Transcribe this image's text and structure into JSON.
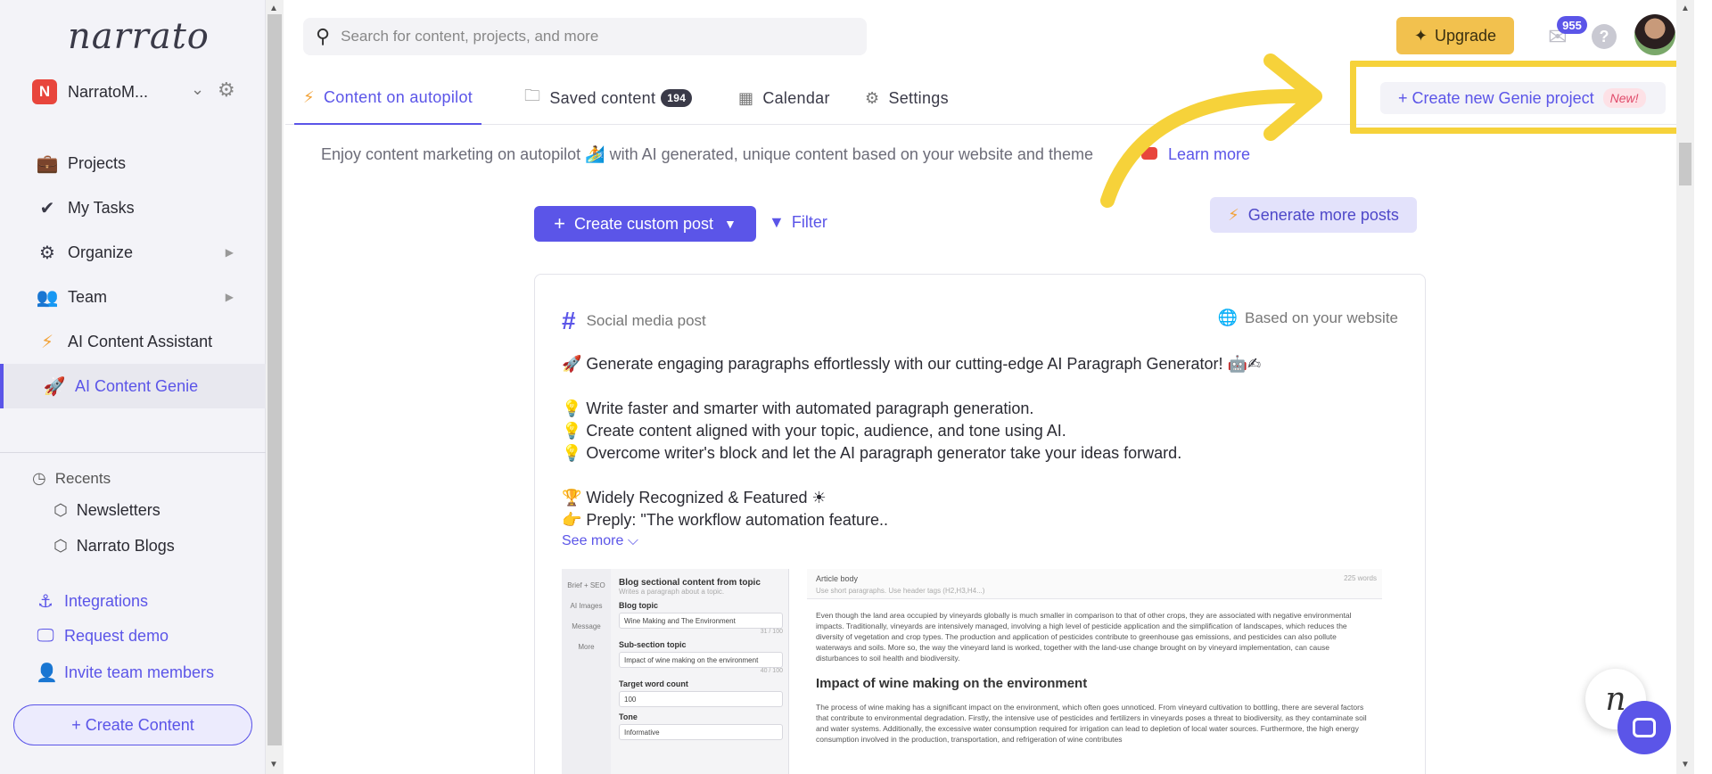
{
  "sidebar": {
    "logo": "narrato",
    "workspace": {
      "initial": "N",
      "name": "NarratoM..."
    },
    "nav": [
      {
        "label": "Projects",
        "icon": "briefcase-icon"
      },
      {
        "label": "My Tasks",
        "icon": "double-check-icon"
      },
      {
        "label": "Organize",
        "icon": "gears-icon"
      },
      {
        "label": "Team",
        "icon": "team-icon"
      },
      {
        "label": "AI Content Assistant",
        "icon": "bolt-icon"
      },
      {
        "label": "AI Content Genie",
        "icon": "rocket-icon"
      }
    ],
    "recents_title": "Recents",
    "recents": [
      "Newsletters",
      "Narrato Blogs"
    ],
    "links": [
      "Integrations",
      "Request demo",
      "Invite team members"
    ],
    "create_content": "+ Create Content"
  },
  "topbar": {
    "search_placeholder": "Search for content, projects, and more",
    "upgrade": "Upgrade",
    "mail_count": "955",
    "help": "?"
  },
  "tabs": [
    {
      "label": "Content on autopilot",
      "active": true
    },
    {
      "label": "Saved content",
      "count": "194"
    },
    {
      "label": "Calendar"
    },
    {
      "label": "Settings"
    }
  ],
  "genie_button": {
    "label": "+ Create new Genie project",
    "badge": "New!"
  },
  "main": {
    "intro": "Enjoy content marketing on autopilot 🏄 with AI generated, unique content based on your website and theme",
    "learn_more": "Learn more",
    "create_custom_post": "Create custom post",
    "filter": "Filter",
    "generate_more": "Generate more posts"
  },
  "card": {
    "type": "Social media post",
    "source": "Based on your website",
    "lines": [
      "🚀 Generate engaging paragraphs effortlessly with our cutting-edge AI Paragraph Generator! 🤖✍",
      "",
      "💡 Write faster and smarter with automated paragraph generation.",
      "💡 Create content aligned with your topic, audience, and tone using AI.",
      "💡 Overcome writer's block and let the AI paragraph generator take your ideas forward.",
      "",
      "🏆 Widely Recognized & Featured ☀",
      "👉 Preply: \"The workflow automation feature.."
    ],
    "see_more": "See more ⌵",
    "preview": {
      "rail": [
        "Brief + SEO",
        "AI Images",
        "Message",
        "More"
      ],
      "form_title": "Blog sectional content from topic",
      "form_sub": "Writes a paragraph about a topic.",
      "fields": [
        {
          "label": "Blog topic",
          "value": "Wine Making and The Environment",
          "count": "31 / 100"
        },
        {
          "label": "Sub-section topic",
          "value": "Impact of wine making on the environment",
          "count": "40 / 100"
        },
        {
          "label": "Target word count",
          "value": "100",
          "count": ""
        },
        {
          "label": "Tone",
          "value": "Informative",
          "count": ""
        }
      ],
      "article_title": "Article body",
      "article_hint": "Use short paragraphs. Use header tags (H2,H3,H4...)",
      "word_count": "225 words",
      "para1": "Even though the land area occupied by vineyards globally is much smaller in comparison to that of other crops, they are associated with negative environmental impacts. Traditionally, vineyards are intensively managed, involving a high level of pesticide application and the simplification of landscapes, which reduces the diversity of vegetation and crop types. The production and application of pesticides contribute to greenhouse gas emissions, and pesticides can also pollute waterways and soils. More so, the way the vineyard land is worked, together with the land-use change brought on by vineyard implementation, can cause disturbances to soil health and biodiversity.",
      "heading": "Impact of wine making on the environment",
      "para2": "The process of wine making has a significant impact on the environment, which often goes unnoticed. From vineyard cultivation to bottling, there are several factors that contribute to environmental degradation. Firstly, the intensive use of pesticides and fertilizers in vineyards poses a threat to biodiversity, as they contaminate soil and water systems. Additionally, the excessive water consumption required for irrigation can lead to depletion of local water sources. Furthermore, the high energy consumption involved in the production, transportation, and refrigeration of wine contributes"
    }
  },
  "colors": {
    "accent": "#5b55e8",
    "highlight": "#f6d23a",
    "upgrade": "#f2c14e"
  }
}
